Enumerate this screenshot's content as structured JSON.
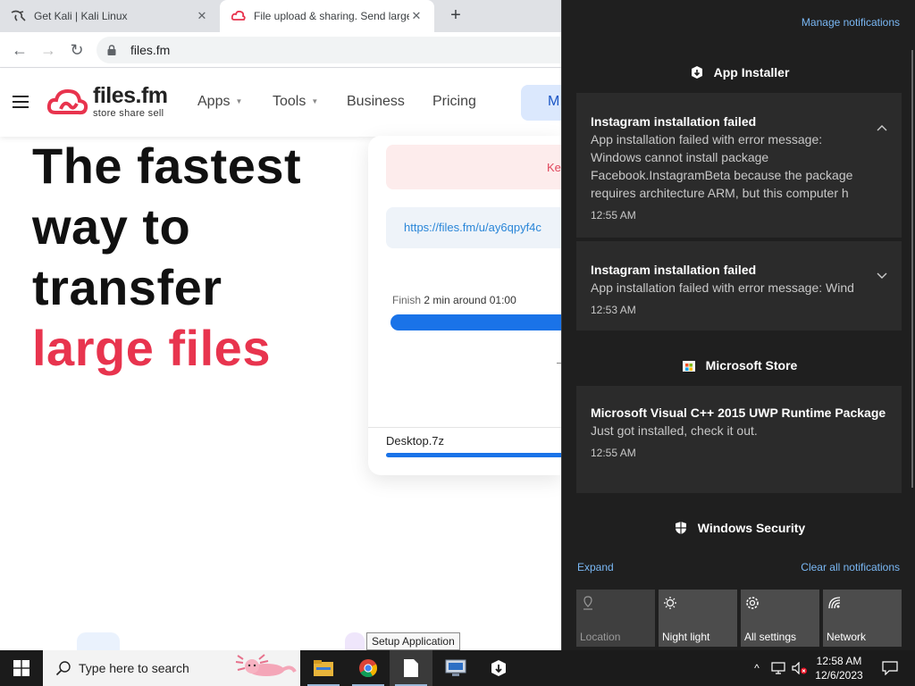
{
  "browser": {
    "tabs": [
      {
        "title": "Get Kali | Kali Linux",
        "close": "✕"
      },
      {
        "title": "File upload & sharing. Send large",
        "close": "✕"
      }
    ],
    "new_tab": "+",
    "back": "←",
    "forward": "→",
    "reload": "↻",
    "url": "files.fm"
  },
  "site": {
    "logo_main": "files.fm",
    "logo_sub": "store  share  sell",
    "nav": [
      {
        "label": "Apps"
      },
      {
        "label": "Tools"
      },
      {
        "label": "Business"
      },
      {
        "label": "Pricing"
      }
    ],
    "cta_label": "M",
    "caret": "▼",
    "hero": {
      "line1": "The fastest",
      "line2": "way to",
      "line3": "transfer",
      "line4": "large files"
    },
    "upload": {
      "error_text": "Ke",
      "link": "https://files.fm/u/ay6qpyf4c",
      "finish_prefix": "Finish",
      "finish_value": "2 min around 01:00",
      "dash": "-",
      "filename": "Desktop.7z",
      "progress": 1.0
    },
    "tooltip": "Setup Application"
  },
  "action_center": {
    "manage": "Manage notifications",
    "groups": [
      {
        "name": "App Installer",
        "icon": "app-installer-icon"
      },
      {
        "name": "Microsoft Store",
        "icon": "store-icon"
      },
      {
        "name": "Windows Security",
        "icon": "shield-icon"
      }
    ],
    "notifications": [
      {
        "title": "Instagram installation failed",
        "body": "App installation failed with error message:\nWindows cannot install package\nFacebook.InstagramBeta because the package\nrequires architecture ARM, but this computer h",
        "time": "12:55 AM"
      },
      {
        "title": "Instagram installation failed",
        "body": "App installation failed with error message: Wind",
        "time": "12:53 AM"
      },
      {
        "title": "Microsoft Visual C++ 2015 UWP Runtime Package",
        "body": "Just got installed, check it out.",
        "time": "12:55 AM"
      }
    ],
    "expand": "Expand",
    "clear_all": "Clear all notifications",
    "quick_actions": [
      {
        "label": "Location",
        "icon": "location-icon",
        "enabled": false
      },
      {
        "label": "Night light",
        "icon": "night-light-icon",
        "enabled": true
      },
      {
        "label": "All settings",
        "icon": "gear-icon",
        "enabled": true
      },
      {
        "label": "Network",
        "icon": "network-icon",
        "enabled": true
      }
    ]
  },
  "taskbar": {
    "search_placeholder": "Type here to search",
    "time": "12:58 AM",
    "date": "12/6/2023",
    "tray_chevron": "^"
  },
  "colors": {
    "accent_red": "#e8344e",
    "link_blue": "#7ab8f5",
    "progress_blue": "#1a73e8",
    "action_center_bg": "#1f1f1f",
    "taskbar_bg": "#1b1b1b"
  }
}
